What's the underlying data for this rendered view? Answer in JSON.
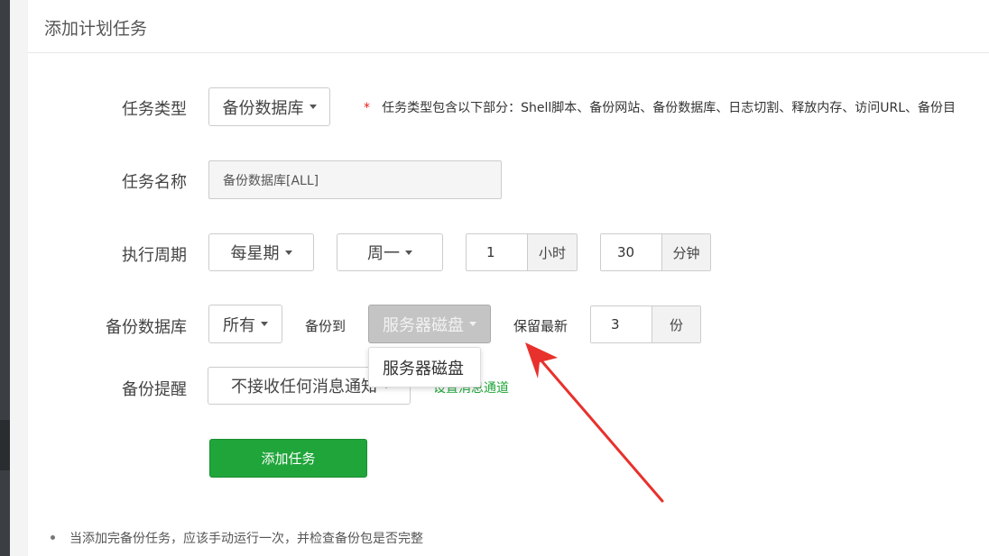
{
  "header": {
    "title": "添加计划任务"
  },
  "form": {
    "task_type": {
      "label": "任务类型",
      "selected": "备份数据库",
      "hint_star": "*",
      "hint": "任务类型包含以下部分：Shell脚本、备份网站、备份数据库、日志切割、释放内存、访问URL、备份目"
    },
    "task_name": {
      "label": "任务名称",
      "value": "备份数据库[ALL]"
    },
    "period": {
      "label": "执行周期",
      "frequency": "每星期",
      "weekday": "周一",
      "hour_value": "1",
      "hour_unit": "小时",
      "minute_value": "30",
      "minute_unit": "分钟"
    },
    "backup_db": {
      "label": "备份数据库",
      "db_selected": "所有",
      "backup_to_label": "备份到",
      "destination_selected": "服务器磁盘",
      "destination_options": [
        "服务器磁盘"
      ],
      "keep_label": "保留最新",
      "keep_value": "3",
      "keep_unit": "份"
    },
    "reminder": {
      "label": "备份提醒",
      "selected": "不接收任何消息通知",
      "link": "设置消息通道"
    },
    "submit_label": "添加任务"
  },
  "notes": [
    "当添加完备份任务，应该手动运行一次，并检查备份包是否完整"
  ],
  "colors": {
    "accent_green": "#20a53a",
    "annotation_red": "#e8312c",
    "hint_red": "#e02020",
    "sidebar_dark": "#3b3f43"
  },
  "icons": {
    "caret": "caret-down-icon",
    "annotation": "red-arrow-annotation"
  }
}
